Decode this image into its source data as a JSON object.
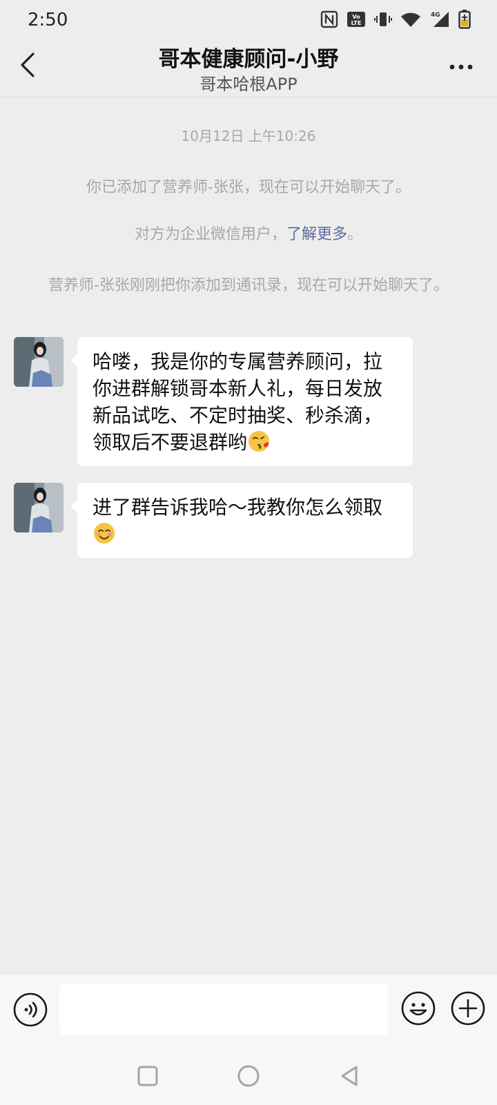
{
  "status_bar": {
    "time": "2:50",
    "icons": [
      "nfc-icon",
      "volte-icon",
      "vibrate-icon",
      "wifi-icon",
      "4g-signal-icon",
      "battery-charging-icon"
    ],
    "network_label": "4G",
    "volte_label": "Vo LTE"
  },
  "header": {
    "title": "哥本健康顾问-小野",
    "subtitle": "哥本哈根APP"
  },
  "chat": {
    "timestamp": "10月12日 上午10:26",
    "system_1": "你已添加了营养师-张张，现在可以开始聊天了。",
    "system_2_prefix": "对方为企业微信用户，",
    "system_2_link": "了解更多",
    "system_2_suffix": "。",
    "system_3": "营养师-张张刚刚把你添加到通讯录，现在可以开始聊天了。",
    "messages": [
      {
        "text": "哈喽，我是你的专属营养顾问，拉你进群解锁哥本新人礼，每日发放新品试吃、不定时抽奖、秒杀滴，领取后不要退群哟",
        "emoji": "kissing-face-emoji"
      },
      {
        "text": "进了群告诉我哈～我教你怎么领取",
        "emoji": "smiling-face-emoji"
      }
    ]
  },
  "input": {
    "value": "",
    "placeholder": ""
  },
  "colors": {
    "background": "#ededed",
    "bubble": "#ffffff",
    "link": "#5b6b9a",
    "system_text": "#a7a7a7"
  }
}
